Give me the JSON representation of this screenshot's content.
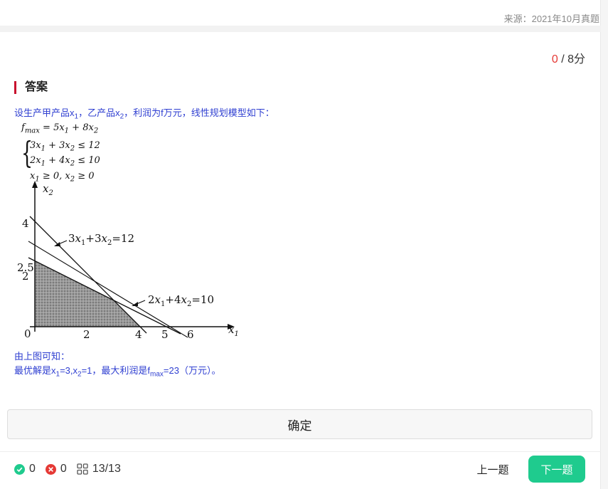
{
  "header": {
    "source": "来源：2021年10月真题"
  },
  "score": {
    "got": "0",
    "sep": " / ",
    "total": "8分"
  },
  "answer": {
    "heading": "答案",
    "intro_parts": [
      "设生产甲产品x",
      "1",
      "，乙产品x",
      "2",
      "，利润为f万元，线性规划模型如下："
    ],
    "model": {
      "objective": "f_max = 5x_1 + 8x_2",
      "constraints": [
        "3x_1 + 3x_2 ≤ 12",
        "2x_1 + 4x_2 ≤ 10",
        "x_1 ≥ 0, x_2 ≥ 0"
      ]
    },
    "conclusion_1": "由上图可知：",
    "conclusion_2_parts": [
      "最优解是x",
      "1",
      "=3,x",
      "2",
      "=1，最大利润是f",
      "max",
      "=23（万元）。"
    ]
  },
  "chart_data": {
    "type": "line",
    "xlabel": "x1",
    "ylabel": "x2",
    "x_ticks": [
      "0",
      "2",
      "4",
      "5",
      "6"
    ],
    "y_ticks": [
      "4",
      "2.5",
      "2"
    ],
    "lines": [
      {
        "name": "3x1+3x2=12",
        "x_intercept": 4,
        "y_intercept": 4
      },
      {
        "name": "2x1+4x2=10",
        "x_intercept": 5,
        "y_intercept": 2.5
      }
    ],
    "feasible_region": [
      [
        0,
        0
      ],
      [
        0,
        2.5
      ],
      [
        3,
        1
      ],
      [
        4,
        0
      ]
    ],
    "labels": {
      "line1": "3x1+3x2=12",
      "line2": "2x1+4x2=10"
    }
  },
  "actions": {
    "confirm": "确定",
    "prev": "上一题",
    "next": "下一题"
  },
  "stats": {
    "correct": "0",
    "wrong": "0",
    "progress": "13/13"
  },
  "colors": {
    "accent": "#c8102e",
    "blue_text": "#2f3fd1",
    "next_button": "#1fcb8e",
    "wrong": "#e53935",
    "correct": "#1fcb8e"
  }
}
